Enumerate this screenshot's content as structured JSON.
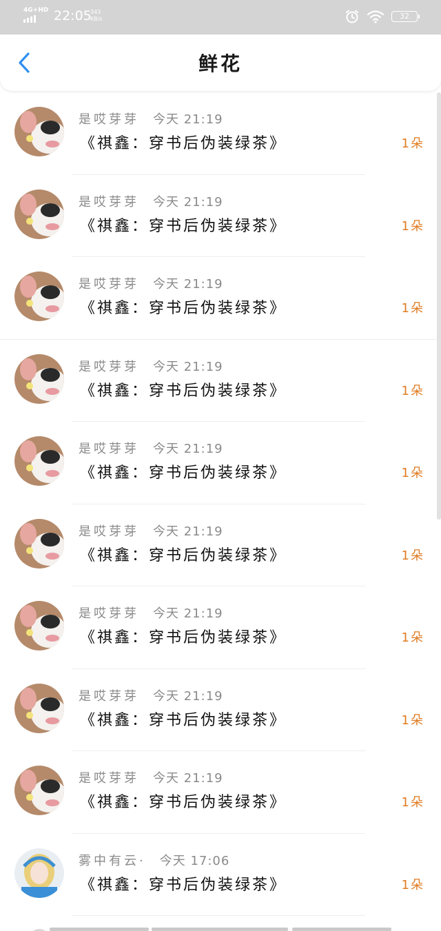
{
  "status_bar": {
    "network": "4G+HD",
    "time": "22:05",
    "speed_value": "343",
    "speed_unit": "KB/s",
    "battery": "32"
  },
  "header": {
    "title": "鲜花"
  },
  "list": [
    {
      "name": "是哎芽芽",
      "time": "今天 21:19",
      "book": "《祺鑫：穿书后伪装绿茶》",
      "count": "1朵",
      "avatar": "corgi"
    },
    {
      "name": "是哎芽芽",
      "time": "今天 21:19",
      "book": "《祺鑫：穿书后伪装绿茶》",
      "count": "1朵",
      "avatar": "corgi"
    },
    {
      "name": "是哎芽芽",
      "time": "今天 21:19",
      "book": "《祺鑫：穿书后伪装绿茶》",
      "count": "1朵",
      "avatar": "corgi"
    },
    {
      "name": "是哎芽芽",
      "time": "今天 21:19",
      "book": "《祺鑫：穿书后伪装绿茶》",
      "count": "1朵",
      "avatar": "corgi"
    },
    {
      "name": "是哎芽芽",
      "time": "今天 21:19",
      "book": "《祺鑫：穿书后伪装绿茶》",
      "count": "1朵",
      "avatar": "corgi"
    },
    {
      "name": "是哎芽芽",
      "time": "今天 21:19",
      "book": "《祺鑫：穿书后伪装绿茶》",
      "count": "1朵",
      "avatar": "corgi"
    },
    {
      "name": "是哎芽芽",
      "time": "今天 21:19",
      "book": "《祺鑫：穿书后伪装绿茶》",
      "count": "1朵",
      "avatar": "corgi"
    },
    {
      "name": "是哎芽芽",
      "time": "今天 21:19",
      "book": "《祺鑫：穿书后伪装绿茶》",
      "count": "1朵",
      "avatar": "corgi"
    },
    {
      "name": "是哎芽芽",
      "time": "今天 21:19",
      "book": "《祺鑫：穿书后伪装绿茶》",
      "count": "1朵",
      "avatar": "corgi"
    },
    {
      "name": "雾中有云·",
      "time": "今天 17:06",
      "book": "《祺鑫：穿书后伪装绿茶》",
      "count": "1朵",
      "avatar": "girl"
    }
  ],
  "colors": {
    "accent_count": "#e07b22",
    "back_arrow": "#2f8ff0",
    "status_bar_bg": "#d4d4d4"
  }
}
